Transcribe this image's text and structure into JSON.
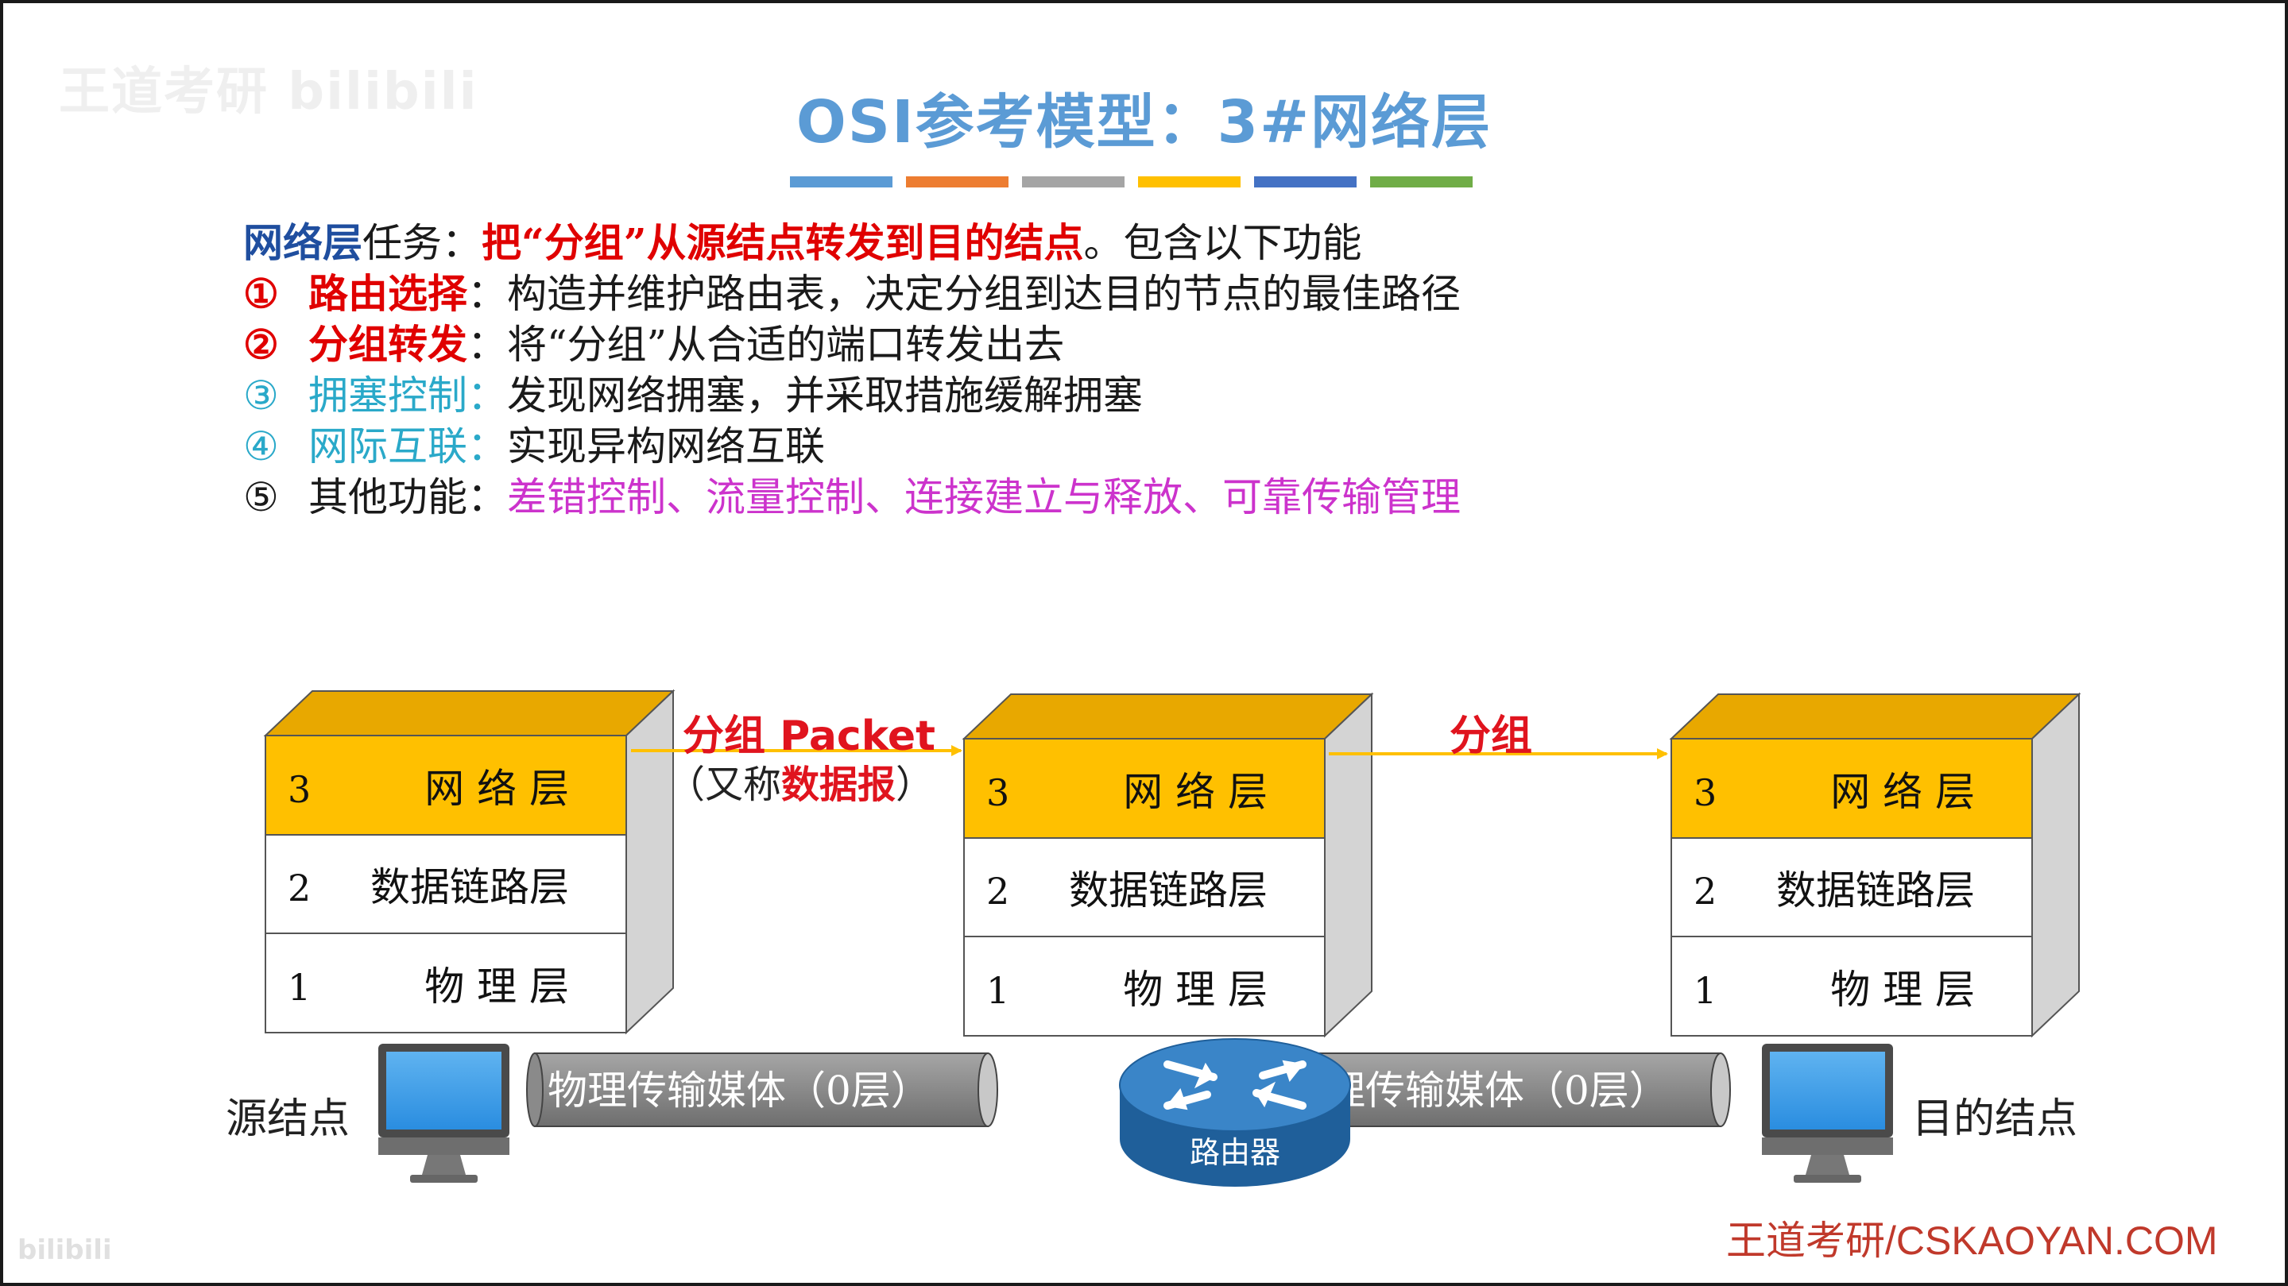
{
  "watermark": "王道考研 bilibili",
  "watermark_small": "bilibili",
  "title": "OSI参考模型：3#网络层",
  "accent_colors": [
    "#5b9bd5",
    "#ed7d31",
    "#a5a5a5",
    "#ffc000",
    "#4472c4",
    "#70ad47"
  ],
  "intro": {
    "term": "网络层",
    "mid": "任务：",
    "highlight": "把“分组”从源结点转发到目的结点",
    "tail": "。包含以下功能"
  },
  "functions": [
    {
      "num": "①",
      "name": "路由选择",
      "sep": "：",
      "desc": "构造并维护路由表，决定分组到达目的节点的最佳路径"
    },
    {
      "num": "②",
      "name": "分组转发",
      "sep": "：",
      "desc": "将“分组”从合适的端口转发出去"
    },
    {
      "num": "③",
      "name": "拥塞控制",
      "sep": "：",
      "desc": "发现网络拥塞，并采取措施缓解拥塞"
    },
    {
      "num": "④",
      "name": "网际互联",
      "sep": "：",
      "desc": "实现异构网络互联"
    },
    {
      "num": "⑤",
      "name": "其他功能",
      "sep": "：",
      "desc": "差错控制、流量控制、连接建立与释放、可靠传输管理"
    }
  ],
  "layers": [
    {
      "num": "3",
      "name": "网 络 层"
    },
    {
      "num": "2",
      "name": "数据链路层"
    },
    {
      "num": "1",
      "name": "物 理 层"
    }
  ],
  "arrow1": {
    "label": "分组 Packet",
    "sub_prefix": "（又称",
    "sub_bold": "数据报",
    "sub_suffix": "）"
  },
  "arrow2": {
    "label": "分组"
  },
  "source_label": "源结点",
  "dest_label": "目的结点",
  "cable_label": "物理传输媒体（0层）",
  "router_label": "路由器",
  "credit": "王道考研/CSKAOYAN.COM"
}
